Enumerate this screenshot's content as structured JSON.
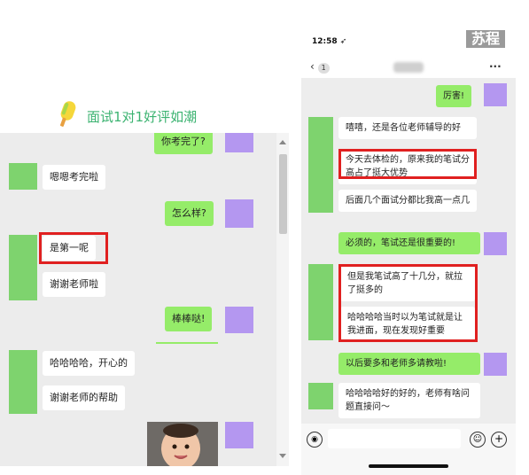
{
  "heading": {
    "text": "面试1对1好评如潮",
    "color": "#3cb371"
  },
  "left_chat": {
    "messages": [
      {
        "side": "right",
        "text": "你考完了?"
      },
      {
        "side": "left",
        "text": "嗯嗯考完啦"
      },
      {
        "side": "right",
        "text": "怎么样?"
      },
      {
        "side": "left",
        "text": "是第一呢"
      },
      {
        "side": "left",
        "text": "谢谢老师啦"
      },
      {
        "side": "right",
        "text": "棒棒哒!"
      },
      {
        "side": "left",
        "text": "哈哈哈哈，开心的"
      },
      {
        "side": "left",
        "text": "谢谢老师的帮助"
      }
    ]
  },
  "phone": {
    "time": "12:58",
    "back_count": "1",
    "more": "···",
    "watermark": "苏程",
    "messages": [
      {
        "side": "right",
        "text": "厉害!"
      },
      {
        "side": "left",
        "text": "嘻嘻，还是各位老师辅导的好"
      },
      {
        "side": "left",
        "text": "今天去体检的，原来我的笔试分高占了挺大优势"
      },
      {
        "side": "left",
        "text": "后面几个面试分都比我高一点几"
      },
      {
        "side": "right",
        "text": "必须的，笔试还是很重要的!"
      },
      {
        "side": "left",
        "text": "但是我笔试高了十几分，就拉了挺多的"
      },
      {
        "side": "left",
        "text": "哈哈哈哈当时以为笔试就是让我进面，现在发现好重要"
      },
      {
        "side": "right",
        "text": "以后要多和老师多请教啦!"
      },
      {
        "side": "left",
        "text": "哈哈哈哈好的好的，老师有啥问题直接问～"
      }
    ],
    "icons": {
      "voice": "voice-icon",
      "emoji": "emoji-icon",
      "plus": "plus-icon"
    }
  },
  "colors": {
    "highlight": "#e02020",
    "bubble_green": "#95ec69",
    "avatar_green": "#7ed36e",
    "avatar_purple": "#b497f0"
  }
}
